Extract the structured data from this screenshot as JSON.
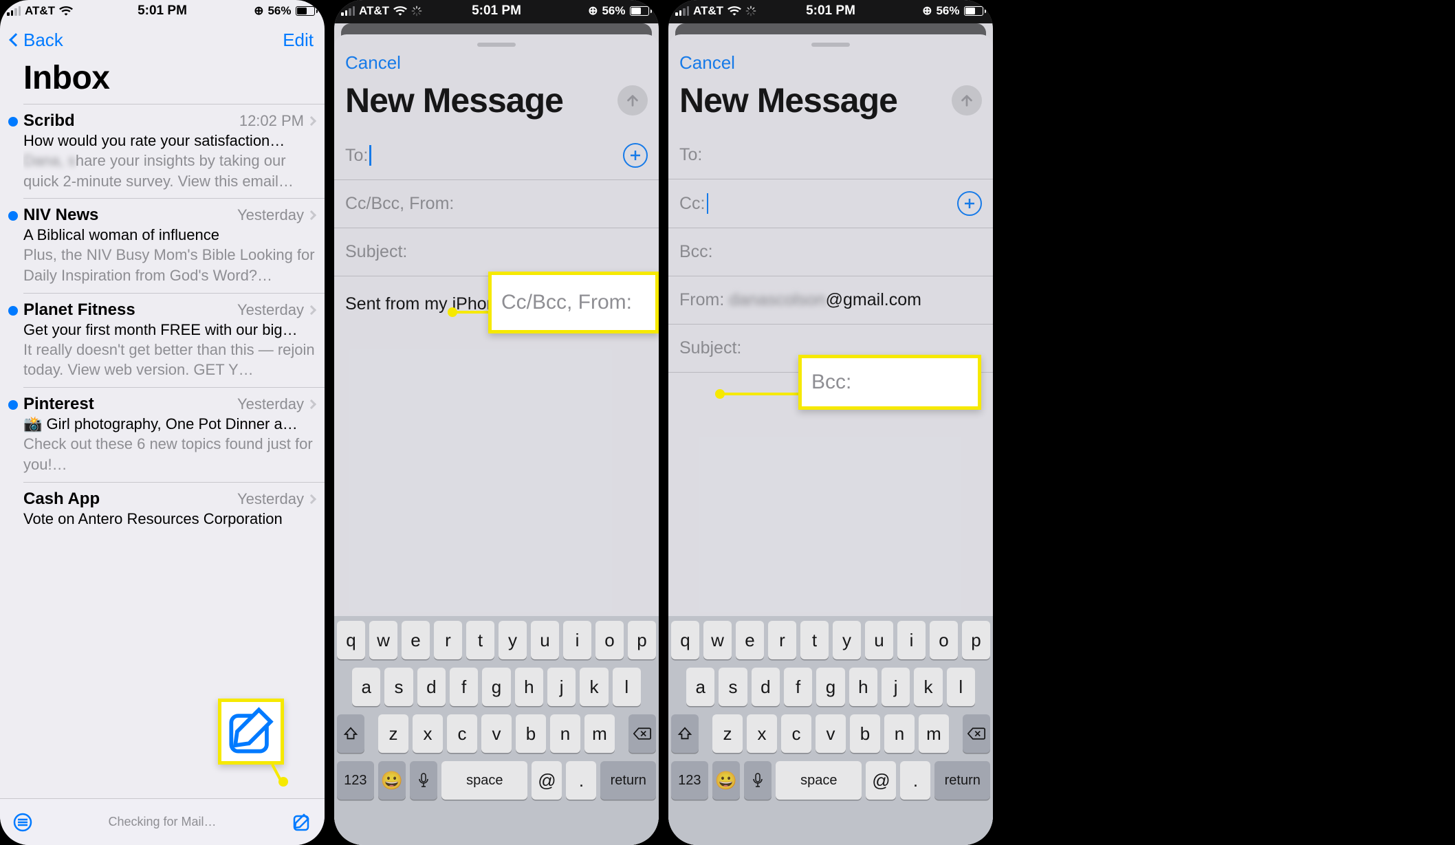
{
  "status": {
    "carrier": "AT&T",
    "time": "5:01 PM",
    "batt_pct": "56%"
  },
  "inbox": {
    "back": "Back",
    "edit": "Edit",
    "title": "Inbox",
    "messages": [
      {
        "sender": "Scribd",
        "time": "12:02 PM",
        "unread": true,
        "subject": "How would you rate your satisfaction…",
        "preview_blur": "Dana, s",
        "preview": "hare your insights by taking our quick 2-minute survey. View this email…"
      },
      {
        "sender": "NIV News",
        "time": "Yesterday",
        "unread": true,
        "subject": "A Biblical woman of influence",
        "preview": "Plus, the NIV Busy Mom's Bible Looking for Daily Inspiration from God's Word?…"
      },
      {
        "sender": "Planet Fitness",
        "time": "Yesterday",
        "unread": true,
        "subject": "Get your first month FREE with our big…",
        "preview": "It really doesn't get better than this — rejoin today. View web version. GET Y…"
      },
      {
        "sender": "Pinterest",
        "time": "Yesterday",
        "unread": true,
        "subject": "📸 Girl photography, One Pot Dinner a…",
        "preview": "Check out these 6 new topics found just for you!…"
      },
      {
        "sender": "Cash App",
        "time": "Yesterday",
        "unread": false,
        "subject": "Vote on Antero Resources Corporation",
        "preview": ""
      }
    ],
    "status_text": "Checking for Mail…"
  },
  "compose1": {
    "cancel": "Cancel",
    "title": "New Message",
    "to_label": "To:",
    "ccbcc_label": "Cc/Bcc, From:",
    "subject_label": "Subject:",
    "body": "Sent from my iPhone",
    "hl": "Cc/Bcc, From:"
  },
  "compose2": {
    "cancel": "Cancel",
    "title": "New Message",
    "to_label": "To:",
    "cc_label": "Cc:",
    "bcc_label": "Bcc:",
    "from_label": "From:",
    "from_blur": "danascolson",
    "from_vis": "@gmail.com",
    "subject_label": "Subject:",
    "hl": "Bcc:"
  },
  "keys": {
    "r1": [
      "q",
      "w",
      "e",
      "r",
      "t",
      "y",
      "u",
      "i",
      "o",
      "p"
    ],
    "r2": [
      "a",
      "s",
      "d",
      "f",
      "g",
      "h",
      "j",
      "k",
      "l"
    ],
    "r3": [
      "z",
      "x",
      "c",
      "v",
      "b",
      "n",
      "m"
    ],
    "num": "123",
    "space": "space",
    "at": "@",
    "dot": ".",
    "ret": "return"
  }
}
